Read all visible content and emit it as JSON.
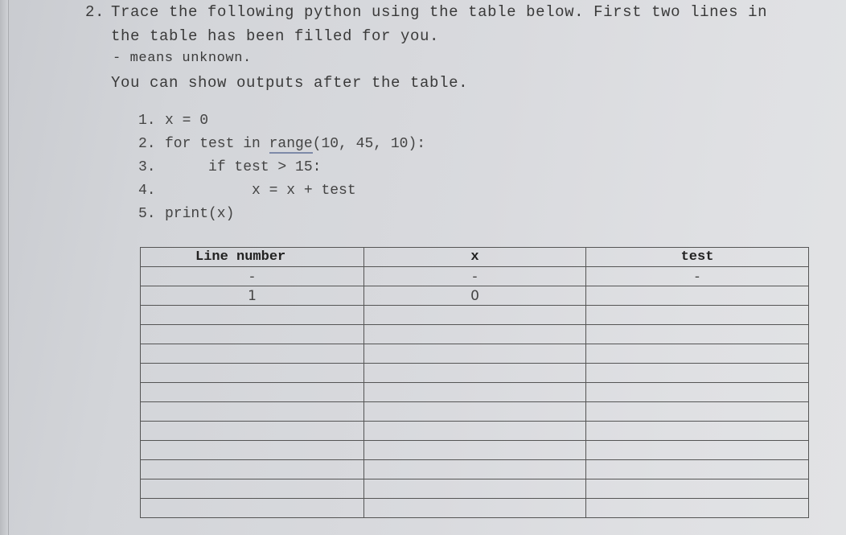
{
  "question": {
    "number": "2.",
    "line1": "Trace the following python using the table below. First two lines in",
    "line2": "the table has been filled for you.",
    "line3": "- means unknown.",
    "line4": "You can show outputs after the table."
  },
  "code": [
    {
      "num": "1.",
      "indent": "",
      "pre": "x = 0",
      "underlined": "",
      "post": ""
    },
    {
      "num": "2.",
      "indent": "",
      "pre": "for test in ",
      "underlined": "range",
      "post": "(10, 45, 10):"
    },
    {
      "num": "3.",
      "indent": "     ",
      "pre": "if test > 15:",
      "underlined": "",
      "post": ""
    },
    {
      "num": "4.",
      "indent": "          ",
      "pre": "x = x + test",
      "underlined": "",
      "post": ""
    },
    {
      "num": "5.",
      "indent": "",
      "pre": "print(x)",
      "underlined": "",
      "post": ""
    }
  ],
  "table": {
    "headers": [
      "Line number",
      "x",
      "test"
    ],
    "rows": [
      [
        "-",
        "-",
        "-"
      ],
      [
        "1",
        "0",
        ""
      ],
      [
        "",
        "",
        ""
      ],
      [
        "",
        "",
        ""
      ],
      [
        "",
        "",
        ""
      ],
      [
        "",
        "",
        ""
      ],
      [
        "",
        "",
        ""
      ],
      [
        "",
        "",
        ""
      ],
      [
        "",
        "",
        ""
      ],
      [
        "",
        "",
        ""
      ],
      [
        "",
        "",
        ""
      ],
      [
        "",
        "",
        ""
      ],
      [
        "",
        "",
        ""
      ]
    ]
  }
}
